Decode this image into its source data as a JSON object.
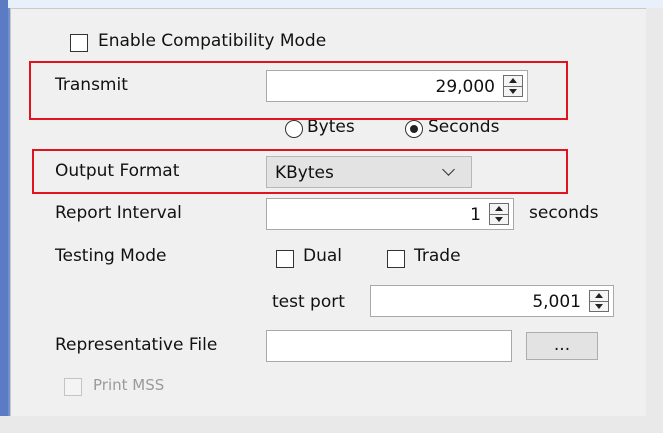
{
  "compat": {
    "label": "Enable Compatibility Mode",
    "checked": false
  },
  "transmit": {
    "label": "Transmit",
    "value": "29,000"
  },
  "transmit_unit": {
    "options": [
      {
        "label": "Bytes",
        "selected": false
      },
      {
        "label": "Seconds",
        "selected": true
      }
    ]
  },
  "output_format": {
    "label": "Output Format",
    "value": "KBytes"
  },
  "report_interval": {
    "label": "Report Interval",
    "value": "1",
    "unit": "seconds"
  },
  "testing_mode": {
    "label": "Testing Mode",
    "dual_label": "Dual",
    "dual_checked": false,
    "trade_label": "Trade",
    "trade_checked": false
  },
  "test_port": {
    "label": "test port",
    "value": "5,001"
  },
  "representative_file": {
    "label": "Representative File",
    "value": "",
    "browse_label": "..."
  },
  "print_mss": {
    "label": "Print MSS",
    "checked": false,
    "disabled": true
  },
  "colors": {
    "highlight": "#e0141e",
    "panel": "#f0f0f0",
    "frame": "#6f8fcf"
  }
}
